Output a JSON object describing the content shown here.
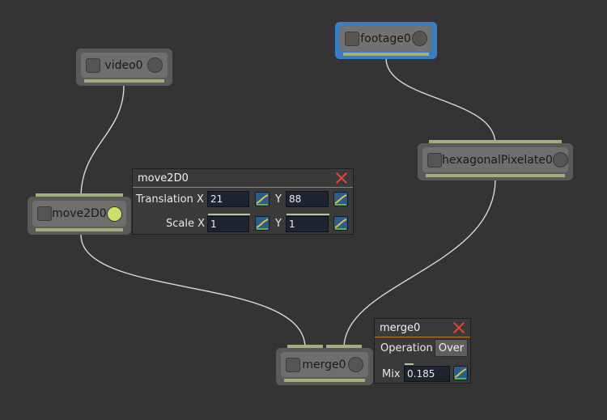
{
  "nodes": {
    "video": {
      "label": "video0"
    },
    "footage": {
      "label": "footage0"
    },
    "hexagonal": {
      "label": "hexagonalPixelate0"
    },
    "move2d": {
      "label": "move2D0"
    },
    "merge": {
      "label": "merge0"
    }
  },
  "move2d_panel": {
    "title": "move2D0",
    "translation_label": "Translation X",
    "translation_x": "21",
    "translation_y_label": "Y",
    "translation_y": "88",
    "scale_label": "Scale X",
    "scale_x": "1",
    "scale_y_label": "Y",
    "scale_y": "1"
  },
  "merge_panel": {
    "title": "merge0",
    "operation_label": "Operation",
    "operation_value": "Over",
    "mix_label": "Mix",
    "mix_value": "0.185"
  },
  "colors": {
    "background": "#343434",
    "selected_border": "#3b7ec4",
    "output_bar": "#9fb07a",
    "active_dot": "#cfe06a",
    "close_x": "#e0443a"
  }
}
